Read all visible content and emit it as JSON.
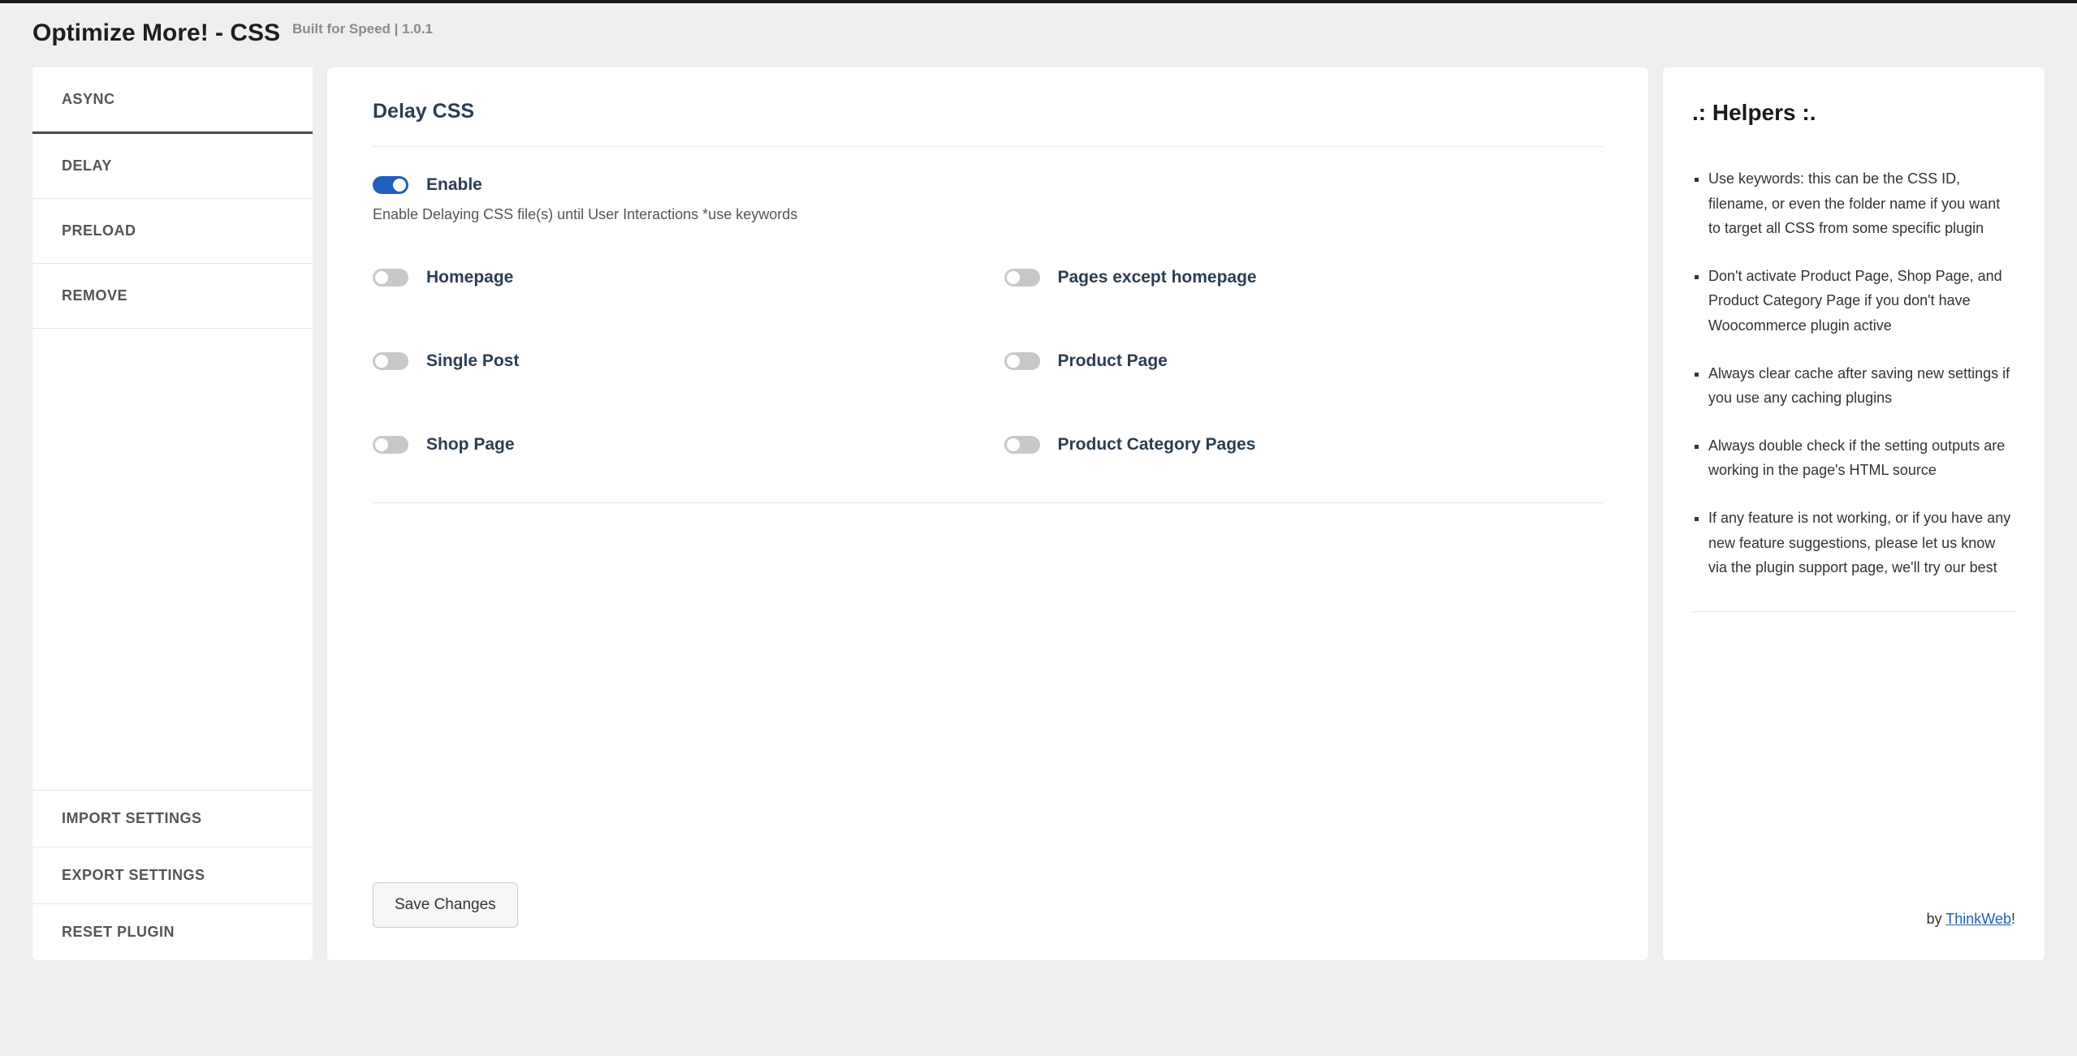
{
  "header": {
    "title": "Optimize More! - CSS",
    "tagline": "Built for Speed | 1.0.1"
  },
  "sidebar": {
    "top": [
      {
        "label": "ASYNC",
        "active": true
      },
      {
        "label": "DELAY",
        "active": false
      },
      {
        "label": "PRELOAD",
        "active": false
      },
      {
        "label": "REMOVE",
        "active": false
      }
    ],
    "bottom": [
      {
        "label": "IMPORT SETTINGS"
      },
      {
        "label": "EXPORT SETTINGS"
      },
      {
        "label": "RESET PLUGIN"
      }
    ]
  },
  "main": {
    "section_title": "Delay CSS",
    "enable": {
      "label": "Enable",
      "on": true,
      "description": "Enable Delaying CSS file(s) until User Interactions *use keywords"
    },
    "options": [
      {
        "label": "Homepage",
        "on": false
      },
      {
        "label": "Pages except homepage",
        "on": false
      },
      {
        "label": "Single Post",
        "on": false
      },
      {
        "label": "Product Page",
        "on": false
      },
      {
        "label": "Shop Page",
        "on": false
      },
      {
        "label": "Product Category Pages",
        "on": false
      }
    ],
    "save_label": "Save Changes"
  },
  "helpers": {
    "title": ".: Helpers :.",
    "items": [
      "Use keywords: this can be the CSS ID, filename, or even the folder name if you want to target all CSS from some specific plugin",
      "Don't activate Product Page, Shop Page, and Product Category Page if you don't have Woocommerce plugin active",
      "Always clear cache after saving new settings if you use any caching plugins",
      "Always double check if the setting outputs are working in the page's HTML source",
      "If any feature is not working, or if you have any new feature suggestions, please let us know via the plugin support page, we'll try our best"
    ],
    "footer_by": "by ",
    "footer_link": "ThinkWeb",
    "footer_excl": "!"
  }
}
